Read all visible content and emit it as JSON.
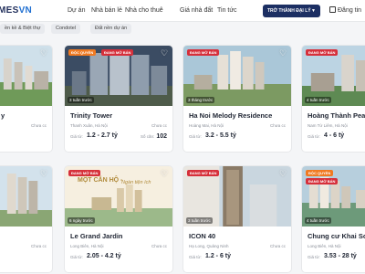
{
  "header": {
    "logo_text": "MES",
    "logo_accent": "VN",
    "nav": [
      "Dự án",
      "Nhà bán lẻ",
      "Nhà cho thuê",
      "Giá nhà đất",
      "Tin tức"
    ],
    "cta_label": "TRỞ THÀNH ĐẠI LÝ",
    "post_label": "Đăng tin"
  },
  "chips": [
    "ền kề & Biệt thự",
    "Condotel",
    "Đất nền dự án"
  ],
  "cards": [
    {
      "title": "y",
      "location": "",
      "status": "Chưa cc",
      "price_label": "",
      "price": "",
      "badges": [],
      "time": "",
      "extra_label": "",
      "extra_value": ""
    },
    {
      "title": "Trinity Tower",
      "location": "Thanh Xuân, Hà Nội",
      "status": "Chưa cc",
      "price_label": "Giá từ:",
      "price": "1.2 - 2.7 tỷ",
      "badges": [
        "ĐỘC QUYỀN",
        "ĐANG MỞ BÁN"
      ],
      "time": "3 tuần trước",
      "extra_label": "Số căn:",
      "extra_value": "102"
    },
    {
      "title": "Ha Noi Melody Residence",
      "location": "Hoàng Mai, Hà Nội",
      "status": "Chưa cc",
      "price_label": "Giá từ:",
      "price": "3.2 - 5.5 tỷ",
      "badges": [
        "ĐANG MỞ BÁN"
      ],
      "time": "3 tháng trước",
      "extra_label": "",
      "extra_value": ""
    },
    {
      "title": "Hoàng Thành Pearl",
      "location": "Nam Từ Liêm, Hà Nội",
      "status": "",
      "price_label": "Giá từ:",
      "price": "4 - 6 tỷ",
      "badges": [
        "ĐANG MỞ BÁN"
      ],
      "time": "4 tuần trước",
      "extra_label": "",
      "extra_value": ""
    },
    {
      "title": "",
      "location": "",
      "status": "Chưa cc",
      "price_label": "",
      "price": "",
      "badges": [],
      "time": "",
      "extra_label": "",
      "extra_value": ""
    },
    {
      "title": "Le Grand Jardin",
      "location": "Long Biên, Hà Nội",
      "status": "Chưa cc",
      "price_label": "Giá từ:",
      "price": "2.05 - 4.2 tỷ",
      "badges": [
        "ĐANG MỞ BÁN"
      ],
      "time": "6 ngày trước",
      "extra_label": "",
      "extra_value": "",
      "banner_line1": "MỘT CĂN HỘ -",
      "banner_line2": "Ngàn tiện ích"
    },
    {
      "title": "ICON 40",
      "location": "Hạ Long, Quảng Ninh",
      "status": "Chưa cc",
      "price_label": "Giá từ:",
      "price": "1.2 - 6 tỷ",
      "badges": [
        "ĐANG MỞ BÁN"
      ],
      "time": "3 tuần trước",
      "extra_label": "",
      "extra_value": ""
    },
    {
      "title": "Chung cư Khai Sơn Ci",
      "location": "Long Biên, Hà Nội",
      "status": "",
      "price_label": "Giá từ:",
      "price": "3.53 - 28 tỷ",
      "badges": [
        "ĐỘC QUYỀN",
        "ĐANG MỞ BÁN"
      ],
      "time": "4 tuần trước",
      "extra_label": "",
      "extra_value": ""
    }
  ],
  "colors": {
    "brand": "#1c2f63",
    "badge_exclusive": "#f07a22",
    "badge_open": "#d6303b"
  },
  "icons": {
    "favorite": "heart-icon",
    "post": "edit-icon",
    "dropdown": "chevron-down-icon"
  }
}
